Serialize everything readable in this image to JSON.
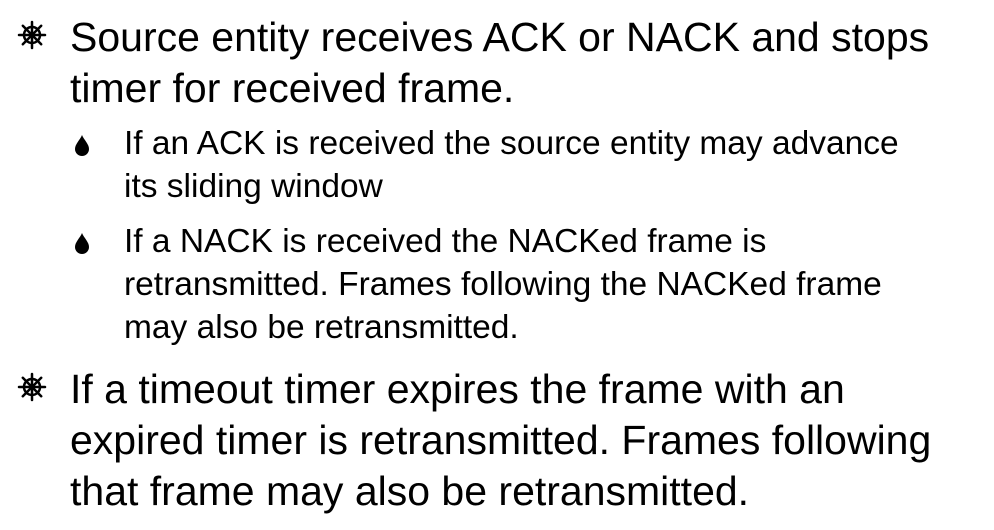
{
  "bullets": [
    {
      "icon": "ship-wheel-bullet-icon",
      "lines": [
        "Source entity receives ACK or NACK and stops",
        "timer for received frame."
      ],
      "sub_bullets": [
        {
          "icon": "drop-bullet-icon",
          "lines": [
            "If an ACK is received the source entity may advance",
            "its sliding window"
          ]
        },
        {
          "icon": "drop-bullet-icon",
          "lines": [
            "If a NACK is received the NACKed frame is",
            "retransmitted. Frames following the NACKed frame",
            "may also be retransmitted."
          ]
        }
      ]
    },
    {
      "icon": "ship-wheel-bullet-icon",
      "lines": [
        "If a timeout timer expires the frame with an",
        "expired timer is retransmitted. Frames following",
        "that frame may also be retransmitted."
      ],
      "sub_bullets": []
    }
  ]
}
